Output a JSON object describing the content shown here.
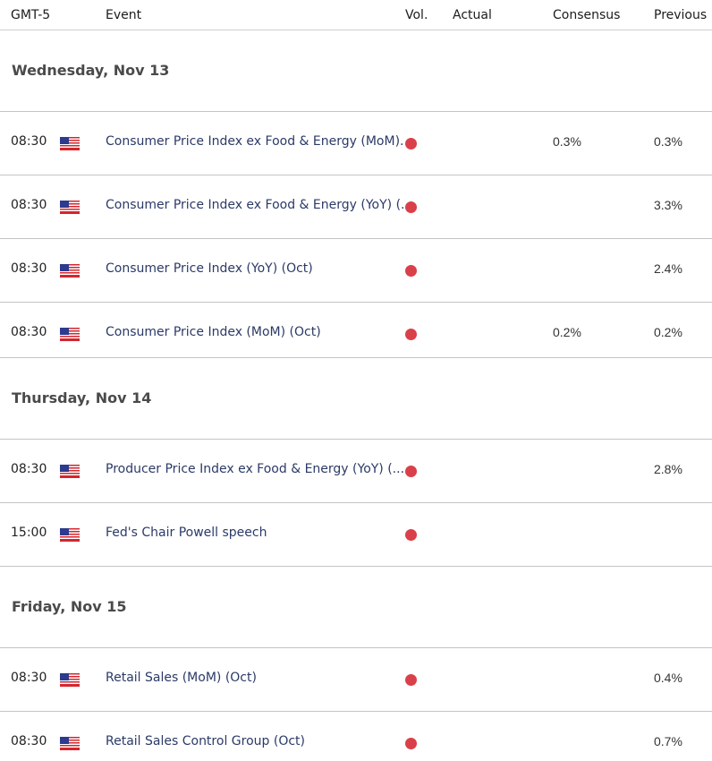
{
  "header": {
    "timezone": "GMT-5",
    "event": "Event",
    "vol": "Vol.",
    "actual": "Actual",
    "consensus": "Consensus",
    "previous": "Previous"
  },
  "colors": {
    "volatility_high": "#d9404a",
    "event_text": "#2b3a67"
  },
  "days": [
    {
      "label": "Wednesday, Nov 13",
      "events": [
        {
          "time": "08:30",
          "country": "us-flag-icon",
          "name": "Consumer Price Index ex Food & Energy (MoM)...",
          "volatility": "high",
          "actual": "",
          "consensus": "0.3%",
          "previous": "0.3%"
        },
        {
          "time": "08:30",
          "country": "us-flag-icon",
          "name": "Consumer Price Index ex Food & Energy (YoY) (...",
          "volatility": "high",
          "actual": "",
          "consensus": "",
          "previous": "3.3%"
        },
        {
          "time": "08:30",
          "country": "us-flag-icon",
          "name": "Consumer Price Index (YoY) (Oct)",
          "volatility": "high",
          "actual": "",
          "consensus": "",
          "previous": "2.4%"
        },
        {
          "time": "08:30",
          "country": "us-flag-icon",
          "name": "Consumer Price Index (MoM) (Oct)",
          "volatility": "high",
          "actual": "",
          "consensus": "0.2%",
          "previous": "0.2%"
        }
      ]
    },
    {
      "label": "Thursday, Nov 14",
      "events": [
        {
          "time": "08:30",
          "country": "us-flag-icon",
          "name": "Producer Price Index ex Food & Energy (YoY) (...",
          "volatility": "high",
          "actual": "",
          "consensus": "",
          "previous": "2.8%"
        },
        {
          "time": "15:00",
          "country": "us-flag-icon",
          "name": "Fed's Chair Powell speech",
          "volatility": "high",
          "actual": "",
          "consensus": "",
          "previous": ""
        }
      ]
    },
    {
      "label": "Friday, Nov 15",
      "events": [
        {
          "time": "08:30",
          "country": "us-flag-icon",
          "name": "Retail Sales (MoM) (Oct)",
          "volatility": "high",
          "actual": "",
          "consensus": "",
          "previous": "0.4%"
        },
        {
          "time": "08:30",
          "country": "us-flag-icon",
          "name": "Retail Sales Control Group (Oct)",
          "volatility": "high",
          "actual": "",
          "consensus": "",
          "previous": "0.7%"
        }
      ]
    }
  ]
}
